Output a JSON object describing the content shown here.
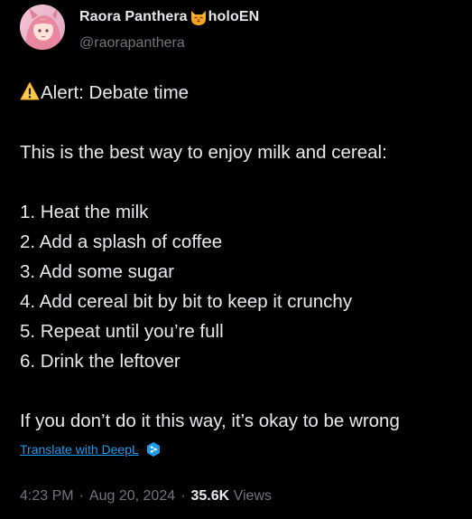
{
  "author": {
    "display_name": "Raora Panthera",
    "name_suffix": "holoEN",
    "handle": "@raorapanthera",
    "avatar_icon": "avatar-image",
    "badge_icon": "cat-face-icon"
  },
  "tweet": {
    "alert_icon": "warning-icon",
    "lines": [
      "Alert: Debate time",
      "",
      "This is the best way to enjoy milk and cereal:",
      "",
      "1. Heat the milk",
      "2. Add a splash of coffee",
      "3. Add some sugar",
      "4. Add cereal bit by bit to keep it crunchy",
      "5. Repeat until you’re full",
      "6. Drink the leftover",
      "",
      "If you don’t do it this way, it’s okay to be wrong"
    ]
  },
  "translate": {
    "label": "Translate with DeepL",
    "icon": "deepl-icon"
  },
  "meta": {
    "time": "4:23 PM",
    "separator": "·",
    "date": "Aug 20, 2024",
    "views_count": "35.6K",
    "views_label": "Views"
  },
  "colors": {
    "background": "#000000",
    "text_primary": "#e7e9ea",
    "text_secondary": "#71767b",
    "link": "#1d9bf0"
  }
}
